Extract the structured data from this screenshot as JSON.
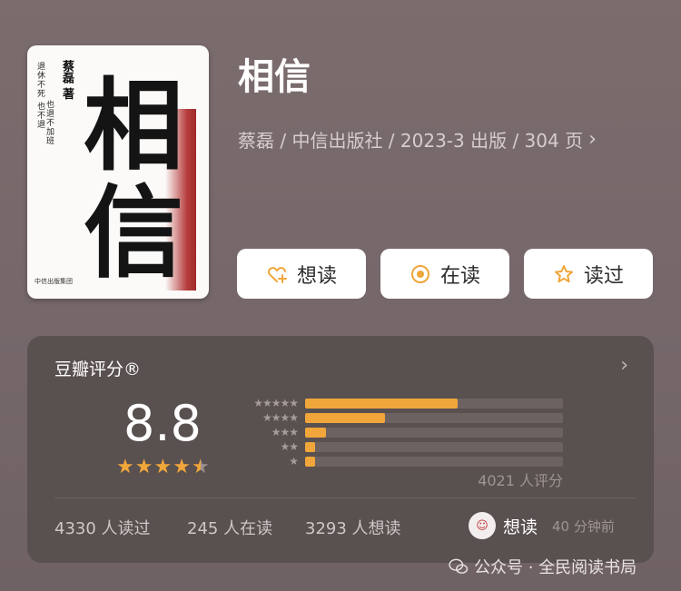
{
  "book": {
    "title": "相信",
    "meta": "蔡磊 / 中信出版社 / 2023-3 出版 / 304 页",
    "cover": {
      "char1": "相",
      "char2": "信",
      "author": "蔡磊 著",
      "line_a": "退休不死 也不退",
      "line_b": "也退不加班",
      "publisher": "中信出版集团"
    }
  },
  "actions": {
    "want": "想读",
    "reading": "在读",
    "read": "读过"
  },
  "rating": {
    "label": "豆瓣评分®",
    "score": "8.8",
    "stars_value": 4.5,
    "distribution": [
      {
        "stars": "★★★★★",
        "fraction": 0.59
      },
      {
        "stars": "★★★★",
        "fraction": 0.31
      },
      {
        "stars": "★★★",
        "fraction": 0.08
      },
      {
        "stars": "★★",
        "fraction": 0.04
      },
      {
        "stars": "★",
        "fraction": 0.04
      }
    ],
    "count": "4021 人评分"
  },
  "stats": {
    "read": "4330 人读过",
    "reading": "245 人在读",
    "want": "3293 人想读"
  },
  "latest": {
    "action": "想读",
    "time": "40 分钟前"
  },
  "watermark": "公众号 · 全民阅读书局",
  "colors": {
    "accent": "#f0a63a",
    "panel": "#595050",
    "background": "#7b6c6d"
  }
}
